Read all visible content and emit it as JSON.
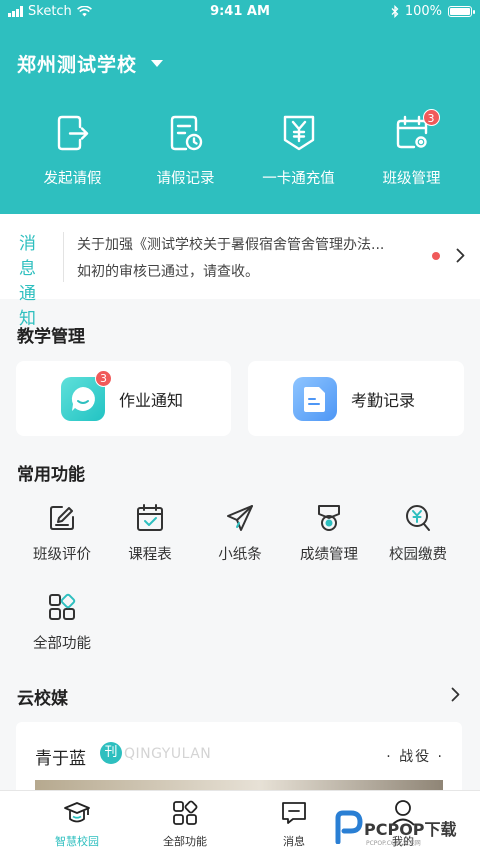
{
  "status_bar": {
    "carrier": "Sketch",
    "time": "9:41 AM",
    "battery": "100%"
  },
  "header": {
    "school_name": "郑州测试学校",
    "quick_actions": [
      {
        "label": "发起请假",
        "icon": "leave-request-icon"
      },
      {
        "label": "请假记录",
        "icon": "leave-record-icon"
      },
      {
        "label": "一卡通充值",
        "icon": "card-recharge-icon"
      },
      {
        "label": "班级管理",
        "icon": "class-manage-icon",
        "badge": "3"
      }
    ]
  },
  "notice": {
    "tag": "消息通知",
    "line1": "关于加强《测试学校关于暑假宿舍管舍管理办法...",
    "line2": "如初的审核已通过，请查收。"
  },
  "teaching": {
    "title": "教学管理",
    "cards": [
      {
        "label": "作业通知",
        "icon": "homework-chat-icon",
        "badge": "3"
      },
      {
        "label": "考勤记录",
        "icon": "attendance-doc-icon"
      }
    ]
  },
  "common": {
    "title": "常用功能",
    "items": [
      {
        "label": "班级评价",
        "icon": "edit-icon"
      },
      {
        "label": "课程表",
        "icon": "calendar-check-icon"
      },
      {
        "label": "小纸条",
        "icon": "paper-plane-icon"
      },
      {
        "label": "成绩管理",
        "icon": "medal-icon"
      },
      {
        "label": "校园缴费",
        "icon": "yuan-search-icon"
      },
      {
        "label": "全部功能",
        "icon": "grid-icon"
      }
    ]
  },
  "media": {
    "title": "云校媒",
    "card": {
      "name": "青于蓝",
      "logo_char": "刊",
      "en_name": "QINGYULAN",
      "category": "· 战役 ·"
    }
  },
  "tabbar": [
    {
      "label": "智慧校园",
      "icon": "graduation-cap-icon",
      "active": true
    },
    {
      "label": "全部功能",
      "icon": "grid-icon"
    },
    {
      "label": "消息",
      "icon": "message-icon"
    },
    {
      "label": "我的",
      "icon": "profile-icon"
    }
  ],
  "watermark": {
    "text": "PCPOP下载",
    "sub": "PCPOP.COM 泡泡网"
  },
  "colors": {
    "brand": "#2ebfbf",
    "badge": "#f05a5a"
  }
}
